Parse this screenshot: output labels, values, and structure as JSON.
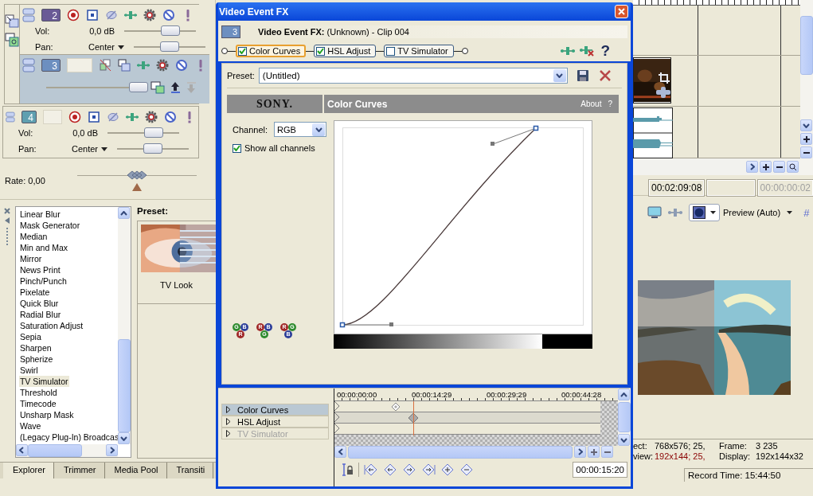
{
  "tracks": [
    {
      "kind": "audio",
      "number": "2",
      "color": "#6a5a96",
      "selected": false,
      "name_field": false,
      "volume": {
        "label": "Vol:",
        "value": "0,0 dB",
        "level": 0.64
      },
      "pan": {
        "label": "Pan:",
        "value": "Center",
        "level": 0.5
      }
    },
    {
      "kind": "video",
      "number": "3",
      "color": "#6d8fc0",
      "selected": true,
      "name_field": true,
      "level": 0.93
    },
    {
      "kind": "audio",
      "number": "4",
      "color": "#5f9fb0",
      "selected": false,
      "name_field": true,
      "volume": {
        "label": "Vol:",
        "value": "0,0 dB",
        "level": 0.64
      },
      "pan": {
        "label": "Pan:",
        "value": "Center",
        "level": 0.5
      }
    }
  ],
  "rate": {
    "text": "Rate: 0,00",
    "level": 0.5
  },
  "effects_list": [
    {
      "label": "Linear Blur",
      "selected": false
    },
    {
      "label": "Mask Generator",
      "selected": false
    },
    {
      "label": "Median",
      "selected": false
    },
    {
      "label": "Min and Max",
      "selected": false
    },
    {
      "label": "Mirror",
      "selected": false
    },
    {
      "label": "News Print",
      "selected": false
    },
    {
      "label": "Pinch/Punch",
      "selected": false
    },
    {
      "label": "Pixelate",
      "selected": false
    },
    {
      "label": "Quick Blur",
      "selected": false
    },
    {
      "label": "Radial Blur",
      "selected": false
    },
    {
      "label": "Saturation Adjust",
      "selected": false
    },
    {
      "label": "Sepia",
      "selected": false
    },
    {
      "label": "Sharpen",
      "selected": false
    },
    {
      "label": "Spherize",
      "selected": false
    },
    {
      "label": "Swirl",
      "selected": false
    },
    {
      "label": "TV Simulator",
      "selected": true
    },
    {
      "label": "Threshold",
      "selected": false
    },
    {
      "label": "Timecode",
      "selected": false
    },
    {
      "label": "Unsharp Mask",
      "selected": false
    },
    {
      "label": "Wave",
      "selected": false
    },
    {
      "label": "(Legacy Plug-In) Broadcas",
      "selected": false
    }
  ],
  "preset_panel": {
    "label": "Preset:",
    "presets": [
      {
        "label": "TV Look",
        "kind": "picture"
      }
    ]
  },
  "bottom_tabs": [
    {
      "label": "Explorer",
      "selected": true
    },
    {
      "label": "Trimmer",
      "selected": false
    },
    {
      "label": "Media Pool",
      "selected": false
    },
    {
      "label": "Transiti",
      "selected": false
    }
  ],
  "timeline": {
    "cursor": "00:02:09:08",
    "selection_length": {
      "text": "00:00:00:02",
      "disabled": true
    }
  },
  "preview": {
    "mode": "Preview (Auto)",
    "grid_symbol": "#"
  },
  "status_rows": [
    {
      "cells": [
        {
          "label": "ect:",
          "value": "768x576; 25,",
          "highlight": false
        },
        {
          "label": "Frame:",
          "value": "3 235",
          "highlight": false
        }
      ]
    },
    {
      "cells": [
        {
          "label": "view:",
          "value": "192x144; 25,",
          "highlight": true
        },
        {
          "label": "Display:",
          "value": "192x144x32",
          "highlight": false
        }
      ]
    }
  ],
  "record_time": "Record Time: 15:44:50",
  "dialog": {
    "title": "Video Event FX",
    "track_number": "3",
    "heading": "**Video Event FX:** (Unknown) - Clip 004",
    "chain": [
      {
        "label": "Color Curves",
        "checked": true,
        "selected": true
      },
      {
        "label": "HSL Adjust",
        "checked": true,
        "selected": false
      },
      {
        "label": "TV Simulator",
        "checked": false,
        "selected": false
      }
    ],
    "help": "?",
    "preset": {
      "label": "Preset:",
      "value": "(Untitled)"
    },
    "plugin": {
      "vendor": "SONY.",
      "name": "Color Curves",
      "about": "About",
      "help": "?"
    },
    "channel": {
      "label": "Channel:",
      "value": "RGB"
    },
    "show_all": {
      "label": "Show all channels",
      "checked": true
    },
    "channel_icons": [
      {
        "letters": [
          {
            "text": "G",
            "color": "#2e8b2e"
          },
          {
            "text": "B",
            "color": "#2d3f9a"
          },
          {
            "text": "R",
            "color": "#a02828"
          }
        ]
      },
      {
        "letters": [
          {
            "text": "R",
            "color": "#a02828"
          },
          {
            "text": "B",
            "color": "#2d3f9a"
          },
          {
            "text": "G",
            "color": "#2e8b2e"
          }
        ]
      },
      {
        "letters": [
          {
            "text": "R",
            "color": "#a02828"
          },
          {
            "text": "G",
            "color": "#2e8b2e"
          },
          {
            "text": "B",
            "color": "#2d3f9a"
          }
        ]
      }
    ],
    "keyframes": {
      "fx": [
        {
          "label": "Color Curves",
          "selected": true,
          "disabled": false
        },
        {
          "label": "HSL Adjust",
          "selected": false,
          "disabled": false
        },
        {
          "label": "TV Simulator",
          "selected": false,
          "disabled": true
        }
      ],
      "ruler": [
        "00:00:00:00",
        "00:00:14:29",
        "00:00:29:29",
        "00:00:44:28"
      ],
      "time": "00:00:15:20"
    }
  }
}
